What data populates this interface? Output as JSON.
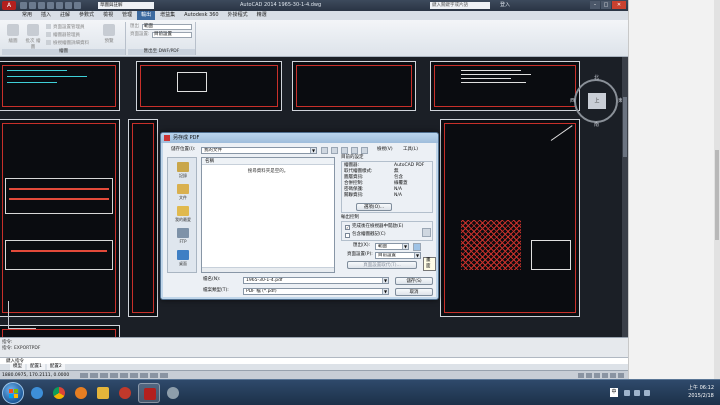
{
  "titlebar": {
    "app_button": "A",
    "workspace": "草圖與註解",
    "title": "AutoCAD 2014    1965-30-1-4.dwg",
    "search_placeholder": "鍵入關鍵字或片語",
    "sign_in": "登入"
  },
  "ribbon": {
    "tabs": [
      "常用",
      "插入",
      "註解",
      "參數式",
      "檢視",
      "管理",
      "輸出",
      "增益集",
      "Autodesk 360",
      "外掛程式",
      "精選"
    ],
    "active_tab": "輸出",
    "group_plot": {
      "label": "繪圖",
      "big1": "繪圖",
      "big2": "批次\n繪圖",
      "small": [
        "頁面設置管理員",
        "繪圖器管理員",
        "檢視繪圖詳細資料"
      ],
      "preview": "預覽"
    },
    "group_export": {
      "label": "匯出至 DWF/PDF",
      "export_label": "匯出",
      "export_value": "範圍",
      "pagesetup_label": "頁面設置:",
      "pagesetup_value": "目前設置"
    }
  },
  "canvas": {
    "viewcube_face": "上",
    "north": "北",
    "south": "南",
    "east": "東",
    "west": "西"
  },
  "command": {
    "history": [
      "指令:",
      "指令: EXPORTPDF"
    ],
    "prompt": "鍵入指令"
  },
  "layout_tabs": [
    "模型",
    "配置1",
    "配置2"
  ],
  "status": {
    "coords": "1880.0975, 170.2111, 0.0000"
  },
  "taskbar": {
    "ime": "中",
    "clock_time": "上午 06:12",
    "clock_date": "2015/2/18"
  },
  "dialog": {
    "title": "另存成 PDF",
    "save_in_label": "儲存位置(I):",
    "save_in_value": "我的文件",
    "views_label": "檢視(V)",
    "tools_label": "工具(L)",
    "places": [
      "記錄",
      "文件",
      "我的最愛",
      "FTP",
      "桌面"
    ],
    "list_header": "名稱",
    "empty_msg": "搜尋資料夾是空的。",
    "summary": {
      "title": "目前的設定",
      "rows": [
        {
          "k": "繪圖器:",
          "v": "AutoCAD PDF"
        },
        {
          "k": "取代繪圖樣式:",
          "v": "無"
        },
        {
          "k": "圖層資訊:",
          "v": "包含"
        },
        {
          "k": "合併控制:",
          "v": "線覆蓋"
        },
        {
          "k": "密碼保護:",
          "v": "N/A"
        },
        {
          "k": "關聯資訊:",
          "v": "N/A"
        }
      ],
      "options_button": "選項(O)..."
    },
    "output": {
      "title": "輸出控制",
      "open_in_viewer": "完成後在檢視器中開啟(E)",
      "include_stamp": "包含繪圖戳記(C)",
      "export_label": "匯出(X):",
      "export_value": "範圍",
      "pagesetup_label": "頁面設置(P):",
      "pagesetup_value": "目前設置",
      "override_button": "頁面設置取代(T)...",
      "tooltip": "畫面"
    },
    "filename_label": "檔名(N):",
    "filename_value": "1965-30-1-4.pdf",
    "filetype_label": "檔案類型(T):",
    "filetype_value": "PDF 檔 (*.pdf)",
    "save_button": "儲存(S)",
    "cancel_button": "取消"
  }
}
